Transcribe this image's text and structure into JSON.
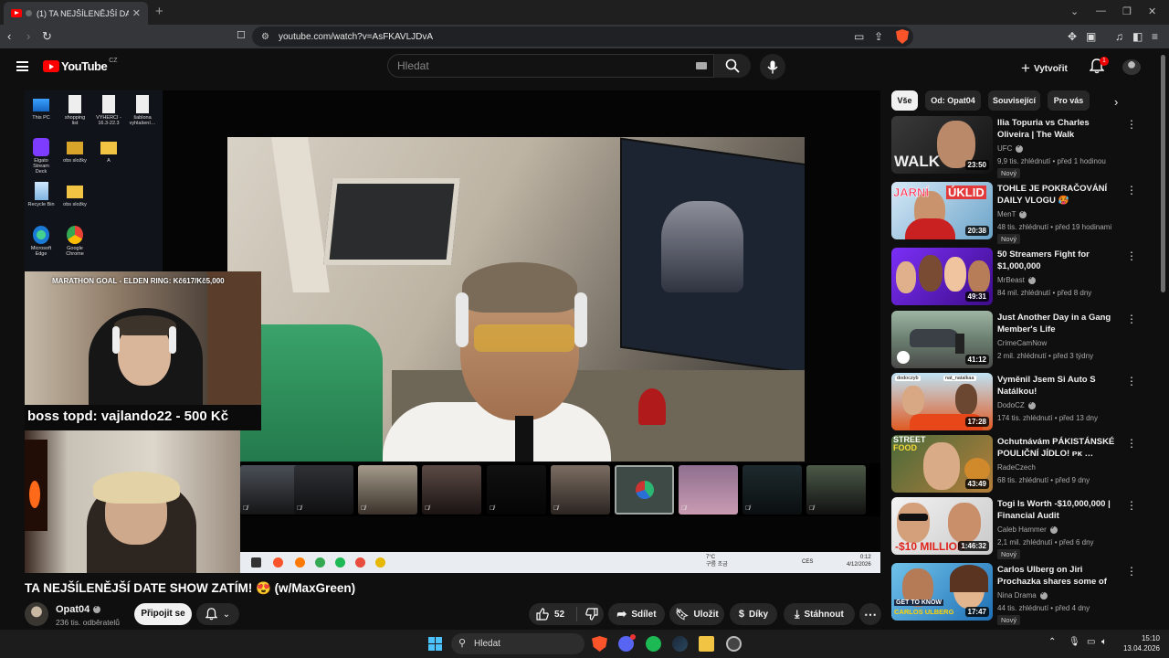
{
  "browser": {
    "tab_title": "(1) TA NEJŠÍLENĚJŠÍ DATE SH…",
    "url": "youtube.com/watch?v=AsFKAVLJDvA"
  },
  "youtube": {
    "logo_text": "YouTube",
    "region": "CZ",
    "search_placeholder": "Hledat",
    "create_label": "Vytvořit",
    "notif_count": "1"
  },
  "player": {
    "desktop_icons": [
      "This PC",
      "shopping list",
      "VYHERCI - 16.3-22.3",
      "šablona vyhlašení…",
      "Elgato Stream Deck",
      "obs složky",
      "A",
      "Recycle Bin",
      "obs složky",
      "Microsoft Edge",
      "Google Chrome"
    ],
    "marathon_goal": "MARATHON GOAL - ELDEN RING: Kč617/Kč5,000",
    "donation_text": "boss topd:  vajlando22 - 500 Kč",
    "taskbar_weather": "7°C",
    "taskbar_weather_sub": "구름 조금",
    "taskbar_lang": "CES",
    "taskbar_time": "0:12",
    "taskbar_date": "4/12/2026"
  },
  "video": {
    "title": "TA NEJŠÍLENĚJŠÍ DATE SHOW ZATÍM! 😍 (w/MaxGreen)",
    "channel": "Opat04",
    "subs": "236 tis. odběratelů",
    "join_label": "Připojit se",
    "likes": "52",
    "share_label": "Sdílet",
    "save_label": "Uložit",
    "thanks_label": "Díky",
    "download_label": "Stáhnout"
  },
  "chips": [
    "Vše",
    "Od: Opat04",
    "Související",
    "Pro vás"
  ],
  "recommendations": [
    {
      "title": "Ilia Topuria vs Charles Oliveira | The Walk",
      "channel": "UFC",
      "verified": true,
      "meta": "9,9 tis. zhlédnutí • před 1 hodinou",
      "duration": "23:50",
      "new": "Nový"
    },
    {
      "title": "TOHLE JE POKRAČOVÁNÍ DAILY VLOGU 🥵",
      "channel": "MenT",
      "verified": true,
      "meta": "48 tis. zhlédnutí • před 19 hodinami",
      "duration": "20:38",
      "new": "Nový"
    },
    {
      "title": "50 Streamers Fight for $1,000,000",
      "channel": "MrBeast",
      "verified": true,
      "meta": "84 mil. zhlédnutí • před 8 dny",
      "duration": "49:31",
      "new": ""
    },
    {
      "title": "Just Another Day in a Gang Member's Life",
      "channel": "CrimeCamNow",
      "verified": false,
      "meta": "2 mil. zhlédnutí • před 3 týdny",
      "duration": "41:12",
      "new": ""
    },
    {
      "title": "Vyměnil Jsem Si Auto S Natálkou!",
      "channel": "DodoCZ",
      "verified": true,
      "meta": "174 tis. zhlédnutí • před 13 dny",
      "duration": "17:28",
      "new": ""
    },
    {
      "title": "Ochutnávám PÁKISTÁNSKÉ POULIČNÍ JÍDLO! ᴘᴋ …",
      "channel": "RadeCzech",
      "verified": false,
      "meta": "68 tis. zhlédnutí • před 9 dny",
      "duration": "43:49",
      "new": ""
    },
    {
      "title": "Togi Is Worth -$10,000,000 | Financial Audit",
      "channel": "Caleb Hammer",
      "verified": true,
      "meta": "2,1 mil. zhlédnutí • před 6 dny",
      "duration": "1:46:32",
      "new": "Nový"
    },
    {
      "title": "Carlos Ulberg on Jiri Prochazka shares some of his funniest …",
      "channel": "Nina Drama",
      "verified": true,
      "meta": "44 tis. zhlédnutí • před 4 dny",
      "duration": "17:47",
      "new": "Nový"
    }
  ],
  "thumb_text": {
    "walk": "WALK",
    "jarni": "JARNÍ",
    "uklid": "ÚKLID",
    "dodo": "dodoczyb",
    "nat": "nat_natalkaa",
    "street": "STREET",
    "food": "FOOD",
    "money": "-$10 MILLION",
    "ulberg": "GET TO KNOW",
    "ulberg2": "CARLOS ULBERG"
  },
  "taskbar": {
    "search": "Hledat",
    "time": "15:10",
    "date": "13.04.2026"
  },
  "colors": {
    "yt_red": "#ff0000",
    "bg": "#0f0f0f",
    "chip_bg": "#272727"
  }
}
